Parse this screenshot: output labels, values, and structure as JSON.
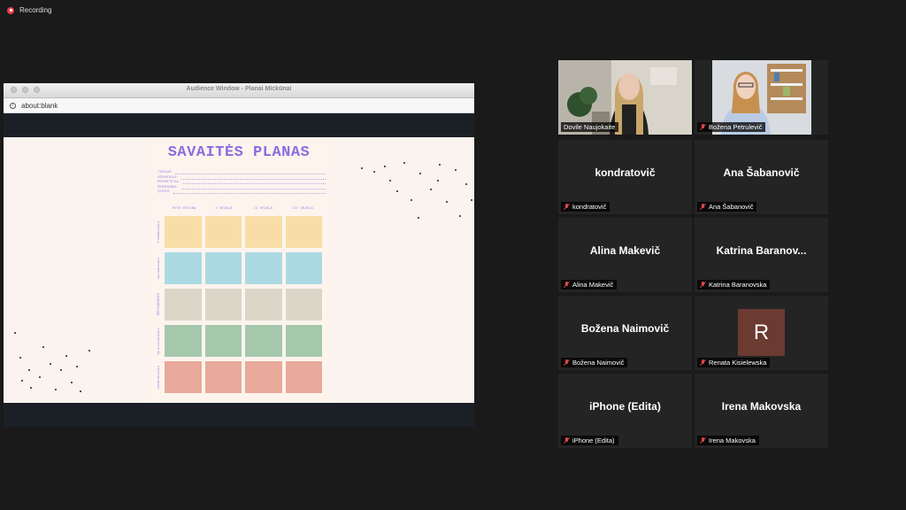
{
  "recording": {
    "label": "Recording"
  },
  "window": {
    "title": "Audience Window - Planai Mickūnai",
    "url": "about:blank"
  },
  "planner": {
    "title": "SAVAITĖS PLANAS",
    "fields": [
      "TIKSLAS:",
      "UŽDAVINIAI:",
      "PRIORITETAI:",
      "PRIMINIMAI:",
      "ĮVYKIS:"
    ],
    "columns": [
      "RYTO RUTINA",
      "I VEIKLA",
      "II VEIKLA",
      "III VEIKLA"
    ],
    "days": [
      "PIRMADIENIS",
      "ANTRADIENIS",
      "TREČIADIENIS",
      "KETVIRTADIENIS",
      "PENKTADIENIS"
    ],
    "row_colors": [
      "#f8dea6",
      "#abdae3",
      "#dcd6c9",
      "#a5c8ac",
      "#e9a99b"
    ]
  },
  "participants": [
    {
      "label": "Dovile Naujokaite",
      "video": true,
      "active": true,
      "muted": false
    },
    {
      "label": "Božena Petrulevič",
      "video": true,
      "muted": true
    },
    {
      "label": "kondratovič",
      "display": "kondratovič",
      "muted": true
    },
    {
      "label": "Ana Šabanovič",
      "display": "Ana Šabanovič",
      "muted": true
    },
    {
      "label": "Alina Makevič",
      "display": "Alina Makevič",
      "muted": true
    },
    {
      "label": "Katrina Baranovska",
      "display": "Katrina  Baranov...",
      "muted": true
    },
    {
      "label": "Božena Naimovič",
      "display": "Božena Naimovič",
      "muted": true
    },
    {
      "label": "Renata Kisielewska",
      "avatar_letter": "R",
      "muted": true
    },
    {
      "label": "iPhone (Edita)",
      "display": "iPhone (Edita)",
      "muted": true
    },
    {
      "label": "Irena Makovska",
      "display": "Irena Makovska",
      "muted": true
    }
  ]
}
